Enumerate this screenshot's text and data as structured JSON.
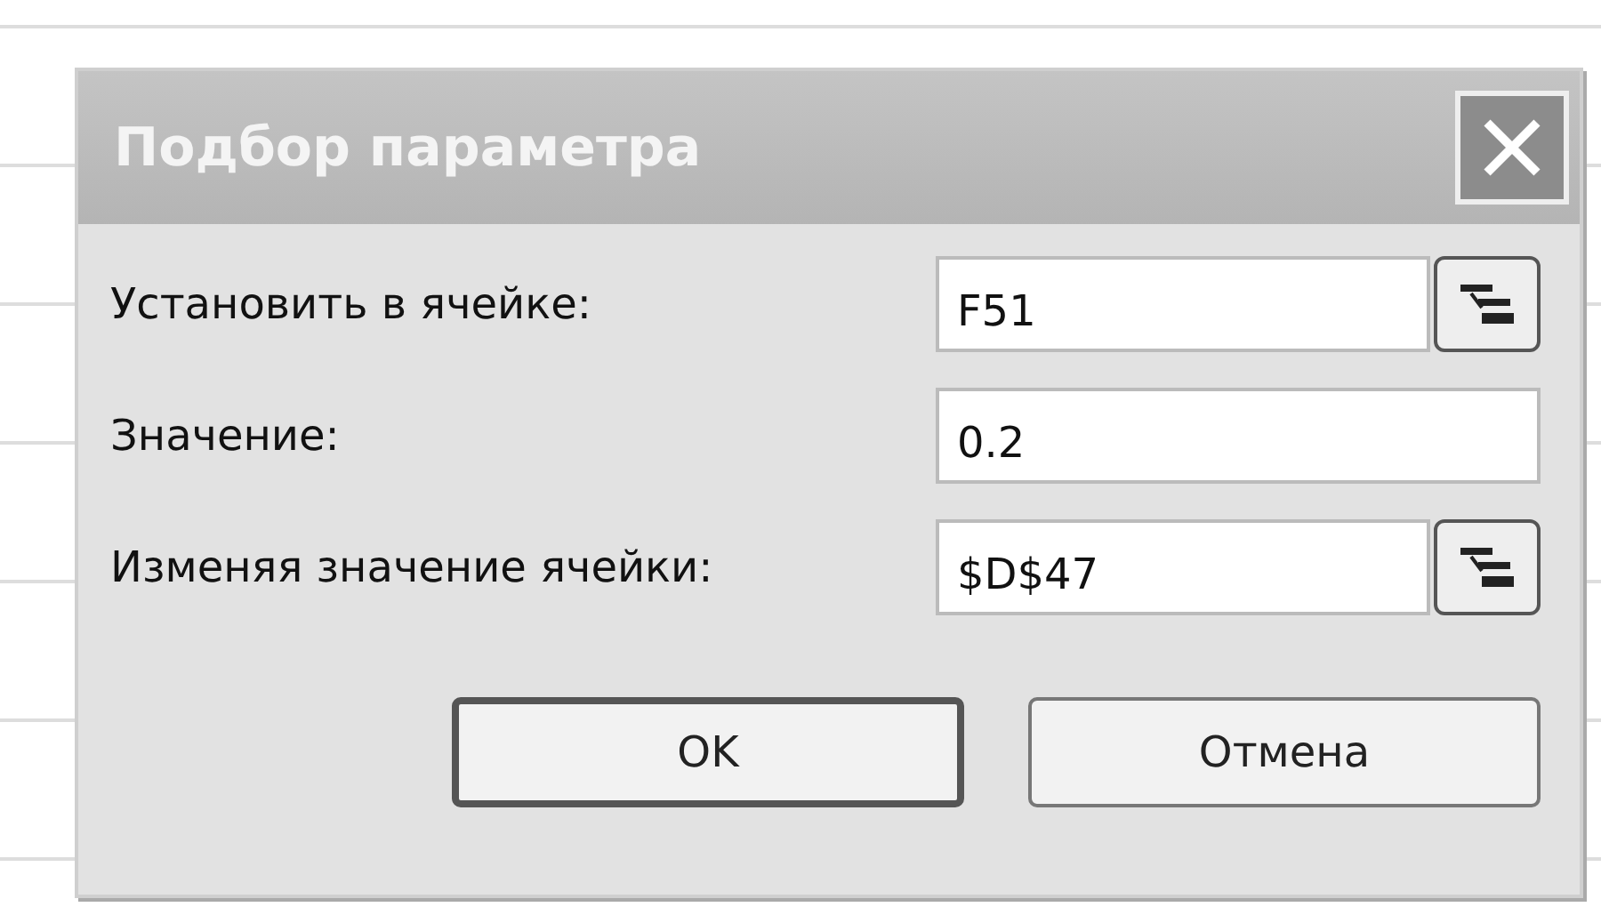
{
  "window": {
    "title": "Подбор параметра"
  },
  "fields": [
    {
      "label": "Установить в ячейке:",
      "value": "F51",
      "kind": "reference"
    },
    {
      "label": "Значение:",
      "value": "0.2",
      "kind": "plain"
    },
    {
      "label": "Изменяя значение ячейки:",
      "value": "$D$47",
      "kind": "reference"
    }
  ],
  "buttons": [
    {
      "label": "OK",
      "default": true
    },
    {
      "label": "Отмена",
      "default": false
    }
  ]
}
